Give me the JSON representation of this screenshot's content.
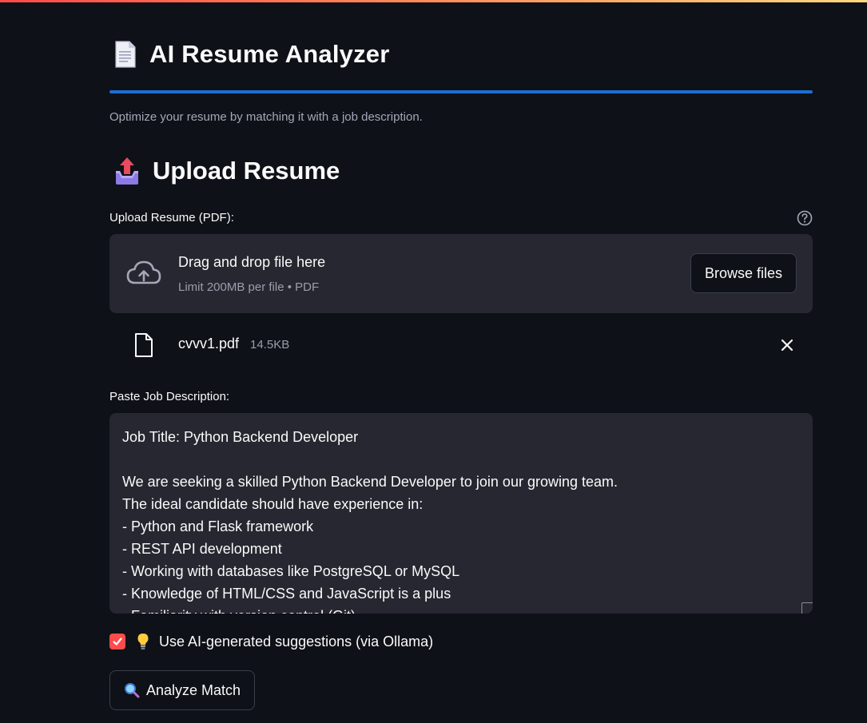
{
  "header": {
    "title": "AI Resume Analyzer",
    "title_icon": "page-document-icon",
    "subtitle": "Optimize your resume by matching it with a job description.",
    "accent_color": "#1c6fd4"
  },
  "upload_section": {
    "heading": "Upload Resume",
    "heading_icon": "outbox-tray-icon",
    "field_label": "Upload Resume (PDF):",
    "dropzone": {
      "title": "Drag and drop file here",
      "limit_text": "Limit 200MB per file • PDF",
      "browse_label": "Browse files"
    },
    "uploaded_file": {
      "name": "cvvv1.pdf",
      "size": "14.5KB"
    }
  },
  "job_description": {
    "label": "Paste Job Description:",
    "value": "Job Title: Python Backend Developer\n\nWe are seeking a skilled Python Backend Developer to join our growing team.\nThe ideal candidate should have experience in:\n- Python and Flask framework\n- REST API development\n- Working with databases like PostgreSQL or MySQL\n- Knowledge of HTML/CSS and JavaScript is a plus\n- Familiarity with version control (Git)"
  },
  "options": {
    "ai_suggestions_checked": true,
    "ai_suggestions_label": "Use AI-generated suggestions (via Ollama)",
    "checkbox_color": "#ff4b4b"
  },
  "actions": {
    "analyze_label": "Analyze Match"
  }
}
